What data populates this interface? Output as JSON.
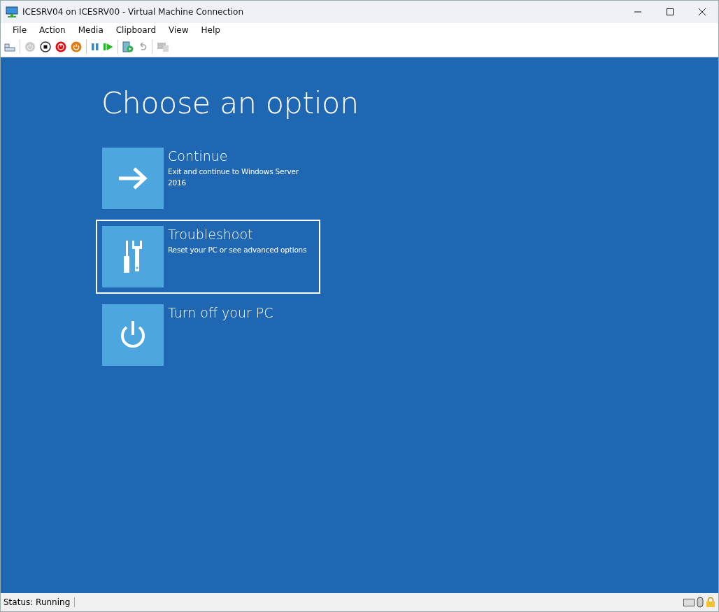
{
  "window": {
    "title": "ICESRV04 on ICESRV00 - Virtual Machine Connection"
  },
  "menu": [
    "File",
    "Action",
    "Media",
    "Clipboard",
    "View",
    "Help"
  ],
  "toolbar": [
    {
      "kind": "ctrl-alt-del",
      "disabled": false
    },
    {
      "kind": "sep"
    },
    {
      "kind": "start",
      "disabled": true
    },
    {
      "kind": "turn-off",
      "disabled": false
    },
    {
      "kind": "shutdown",
      "disabled": false
    },
    {
      "kind": "save",
      "disabled": false
    },
    {
      "kind": "sep"
    },
    {
      "kind": "pause",
      "disabled": false
    },
    {
      "kind": "resume",
      "disabled": false
    },
    {
      "kind": "sep"
    },
    {
      "kind": "checkpoint",
      "disabled": false
    },
    {
      "kind": "revert",
      "disabled": true
    },
    {
      "kind": "sep"
    },
    {
      "kind": "enhanced",
      "disabled": true
    }
  ],
  "screen": {
    "heading": "Choose an option",
    "options": [
      {
        "kind": "arrow",
        "title": "Continue",
        "description": "Exit and continue to Windows Server 2016",
        "selected": false
      },
      {
        "kind": "tools",
        "title": "Troubleshoot",
        "description": "Reset your PC or see advanced options",
        "selected": true
      },
      {
        "kind": "power",
        "title": "Turn off your PC",
        "selected": false
      }
    ]
  },
  "status_bar": {
    "text": "Status: Running"
  }
}
